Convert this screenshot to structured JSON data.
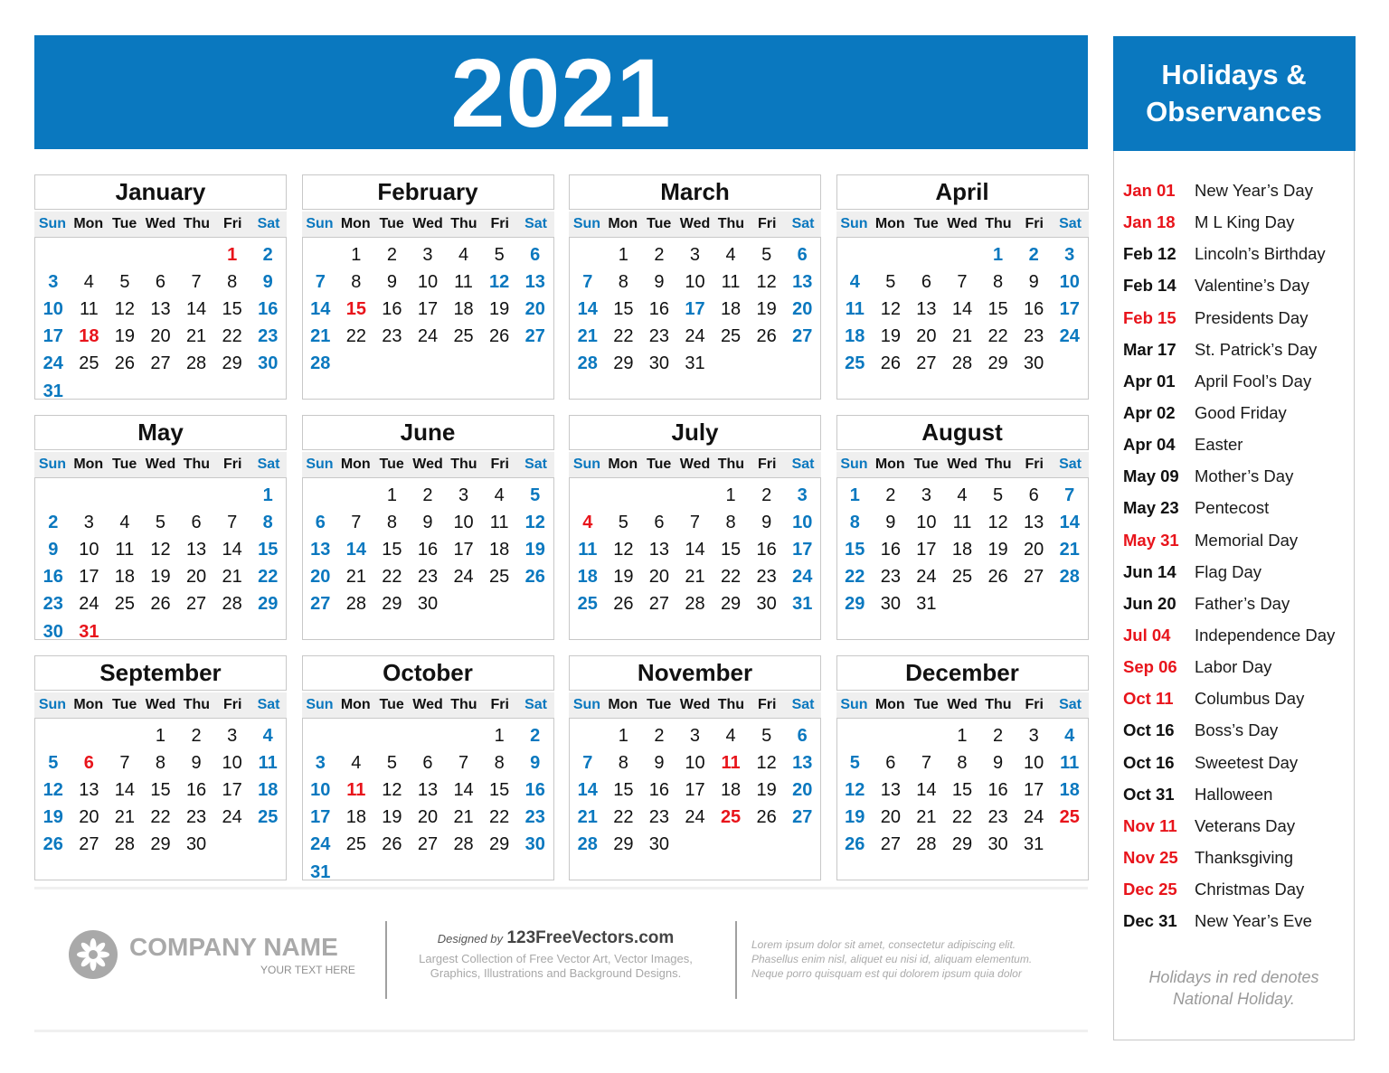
{
  "year": "2021",
  "colors": {
    "accent_blue": "#0a78bf",
    "holiday_red": "#e8141b"
  },
  "weekdays": [
    "Sun",
    "Mon",
    "Tue",
    "Wed",
    "Thu",
    "Fri",
    "Sat"
  ],
  "months": [
    {
      "name": "January",
      "start": 5,
      "days": 31,
      "holidays": [
        1,
        18
      ],
      "observances": []
    },
    {
      "name": "February",
      "start": 1,
      "days": 28,
      "holidays": [
        15
      ],
      "observances": [
        12
      ]
    },
    {
      "name": "March",
      "start": 1,
      "days": 31,
      "holidays": [],
      "observances": [
        17
      ]
    },
    {
      "name": "April",
      "start": 4,
      "days": 30,
      "holidays": [],
      "observances": [
        1,
        2
      ]
    },
    {
      "name": "May",
      "start": 6,
      "days": 31,
      "holidays": [
        31
      ],
      "observances": []
    },
    {
      "name": "June",
      "start": 2,
      "days": 30,
      "holidays": [],
      "observances": [
        14
      ]
    },
    {
      "name": "July",
      "start": 4,
      "days": 31,
      "holidays": [
        4
      ],
      "observances": []
    },
    {
      "name": "August",
      "start": 0,
      "days": 31,
      "holidays": [],
      "observances": []
    },
    {
      "name": "September",
      "start": 3,
      "days": 30,
      "holidays": [
        6
      ],
      "observances": []
    },
    {
      "name": "October",
      "start": 5,
      "days": 31,
      "holidays": [
        11
      ],
      "observances": []
    },
    {
      "name": "November",
      "start": 1,
      "days": 30,
      "holidays": [
        11,
        25
      ],
      "observances": []
    },
    {
      "name": "December",
      "start": 3,
      "days": 31,
      "holidays": [
        25
      ],
      "observances": []
    }
  ],
  "sidebar": {
    "title_line1": "Holidays &",
    "title_line2": "Observances",
    "items": [
      {
        "date": "Jan 01",
        "name": "New Year’s Day",
        "national": true
      },
      {
        "date": "Jan 18",
        "name": "M L King Day",
        "national": true
      },
      {
        "date": "Feb 12",
        "name": "Lincoln’s Birthday",
        "national": false
      },
      {
        "date": "Feb 14",
        "name": "Valentine’s Day",
        "national": false
      },
      {
        "date": "Feb 15",
        "name": "Presidents Day",
        "national": true
      },
      {
        "date": "Mar 17",
        "name": "St. Patrick’s Day",
        "national": false
      },
      {
        "date": "Apr 01",
        "name": "April Fool’s Day",
        "national": false
      },
      {
        "date": "Apr 02",
        "name": "Good Friday",
        "national": false
      },
      {
        "date": "Apr 04",
        "name": "Easter",
        "national": false
      },
      {
        "date": "May 09",
        "name": "Mother’s Day",
        "national": false
      },
      {
        "date": "May 23",
        "name": "Pentecost",
        "national": false
      },
      {
        "date": "May 31",
        "name": "Memorial Day",
        "national": true
      },
      {
        "date": "Jun 14",
        "name": "Flag Day",
        "national": false
      },
      {
        "date": "Jun 20",
        "name": "Father’s Day",
        "national": false
      },
      {
        "date": "Jul 04",
        "name": "Independence Day",
        "national": true
      },
      {
        "date": "Sep 06",
        "name": "Labor Day",
        "national": true
      },
      {
        "date": "Oct 11",
        "name": "Columbus Day",
        "national": true
      },
      {
        "date": "Oct 16",
        "name": "Boss’s Day",
        "national": false
      },
      {
        "date": "Oct 16",
        "name": "Sweetest Day",
        "national": false
      },
      {
        "date": "Oct 31",
        "name": "Halloween",
        "national": false
      },
      {
        "date": "Nov 11",
        "name": "Veterans Day",
        "national": true
      },
      {
        "date": "Nov 25",
        "name": "Thanksgiving",
        "national": true
      },
      {
        "date": "Dec 25",
        "name": "Christmas Day",
        "national": true
      },
      {
        "date": "Dec 31",
        "name": "New Year’s Eve",
        "national": false
      }
    ],
    "note_line1": "Holidays in red denotes",
    "note_line2": "National Holiday."
  },
  "footer": {
    "company_name": "COMPANY NAME",
    "tagline": "YOUR TEXT HERE",
    "designed_by_label": "Designed by",
    "designed_by_site": "123FreeVectors.com",
    "designed_desc_line1": "Largest Collection of Free Vector Art, Vector Images,",
    "designed_desc_line2": "Graphics, Illustrations and Background Designs.",
    "lorem_line1": "Lorem ipsum dolor sit amet, consectetur adipiscing elit.",
    "lorem_line2": "Phasellus enim nisl, aliquet eu nisi id, aliquam elementum.",
    "lorem_line3": "Neque porro quisquam est qui dolorem ipsum quia dolor"
  }
}
